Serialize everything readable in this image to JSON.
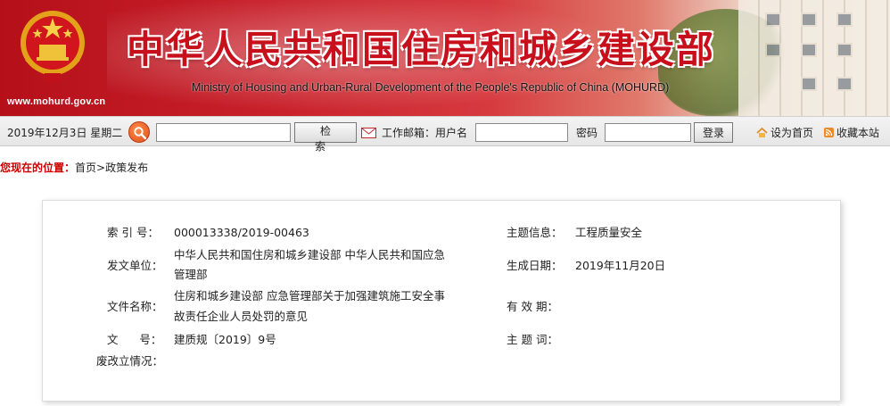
{
  "header": {
    "site_url": "www.mohurd.gov.cn",
    "title_cn": "中华人民共和国住房和城乡建设部",
    "title_en": "Ministry of Housing and Urban-Rural Development of the People's Republic of China (MOHURD)",
    "colors": {
      "brand_red": "#c8101c",
      "banner_dark": "#b5101a"
    }
  },
  "toolbar": {
    "date": "2019年12月3日 星期二",
    "search_value": "",
    "search_label": "检 索",
    "mail_label": "工作邮箱：用户名",
    "username_value": "",
    "password_label": "密码",
    "password_value": "",
    "login_label": "登录",
    "home_label": "设为首页",
    "favorite_label": "收藏本站"
  },
  "breadcrumb": {
    "label": "您现在的位置：",
    "home": "首页",
    "separator": ">",
    "current": "政策发布"
  },
  "info": {
    "index_label": "索 引 号：",
    "index_value": "000013338/2019-00463",
    "topic_label": "主题信息：",
    "topic_value": "工程质量安全",
    "issuer_label": "发文单位：",
    "issuer_line1": "中华人民共和国住房和城乡建设部 中华人民共和国应急",
    "issuer_line2": "管理部",
    "date_label": "生成日期：",
    "date_value": "2019年11月20日",
    "name_label": "文件名称：",
    "name_line1": "住房和城乡建设部 应急管理部关于加强建筑施工安全事",
    "name_line2": "故责任企业人员处罚的意见",
    "validity_label": "有 效 期：",
    "validity_value": "",
    "docno_label": "文      号：",
    "docno_value": "建质规〔2019〕9号",
    "keywords_label": "主 题 词：",
    "keywords_value": "",
    "status_label": "废改立情况：",
    "status_value": ""
  }
}
